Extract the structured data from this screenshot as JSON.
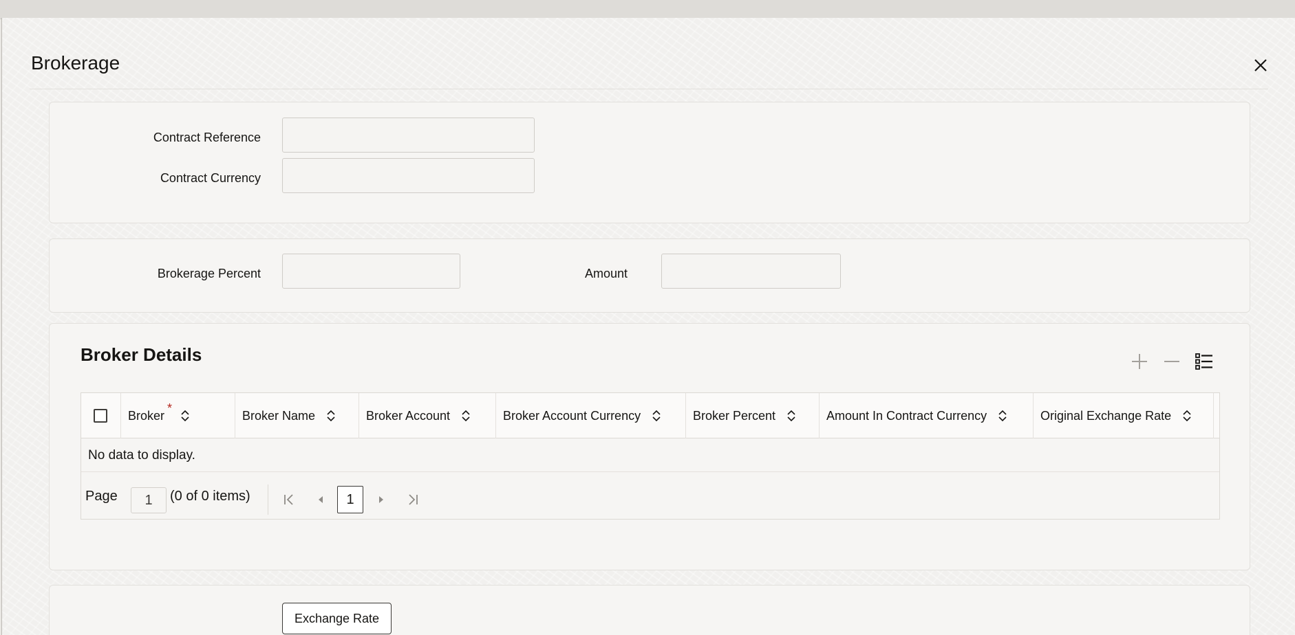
{
  "dialog": {
    "title": "Brokerage",
    "close_icon": "close-icon"
  },
  "contract": {
    "reference_label": "Contract Reference",
    "reference_value": "",
    "currency_label": "Contract Currency",
    "currency_value": ""
  },
  "brokerage": {
    "percent_label": "Brokerage Percent",
    "percent_value": "",
    "amount_label": "Amount",
    "amount_value": ""
  },
  "broker_details": {
    "title": "Broker Details",
    "toolbar_icons": [
      "add-icon",
      "remove-icon",
      "list-view-icon"
    ],
    "columns": [
      "Broker",
      "Broker Name",
      "Broker Account",
      "Broker Account Currency",
      "Broker Percent",
      "Amount In Contract Currency",
      "Original Exchange Rate"
    ],
    "required_marker": "*",
    "empty_text": "No data to display.",
    "pagination": {
      "page_label": "Page",
      "page_value": "1",
      "count_text": "(0 of 0 items)",
      "current_page": "1"
    }
  },
  "footer": {
    "exchange_rate_label": "Exchange Rate"
  },
  "colors": {
    "required": "#b3261e",
    "text": "#161513",
    "panel": "#f6f5f3"
  }
}
